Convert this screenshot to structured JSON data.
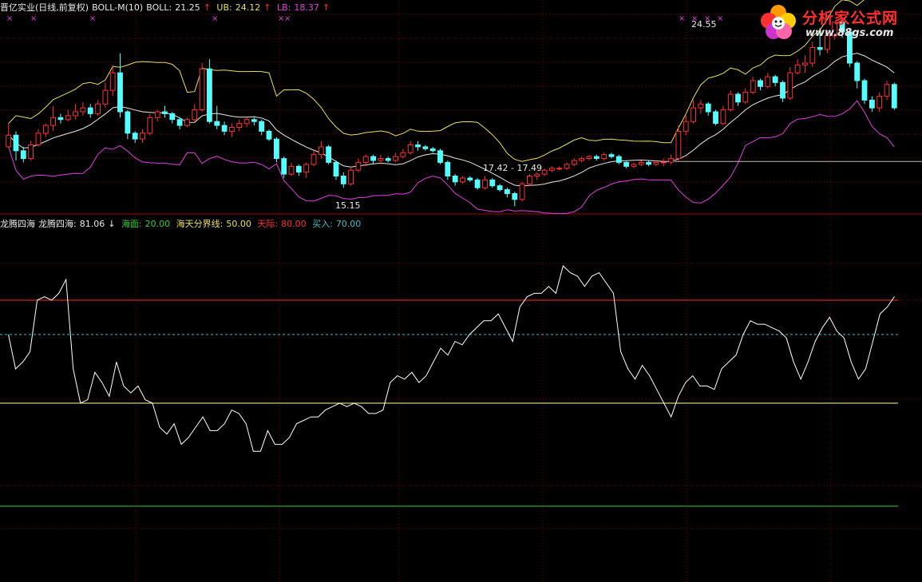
{
  "header_top": {
    "stock": "晋亿实业(日线,前复权)",
    "indicator": "BOLL-M(10)",
    "boll_label": "BOLL:",
    "boll_value": "21.25",
    "ub_label": "UB:",
    "ub_value": "24.12",
    "lb_label": "LB:",
    "lb_value": "18.37",
    "up_arrow": "↑"
  },
  "header_mid": {
    "name": "龙腾四海",
    "line_label": "龙腾四海:",
    "line_value": "81.06",
    "down_arrow": "↓",
    "sea_label": "海面:",
    "sea_value": "20.00",
    "divide_label": "海天分界线:",
    "divide_value": "50.00",
    "sky_label": "天际:",
    "sky_value": "80.00",
    "buy_label": "买入:",
    "buy_value": "70.00"
  },
  "logo": {
    "title": "分析家公式网",
    "url": "www.88gs.com"
  },
  "price_labels": {
    "high": "24.55",
    "low": "15.15",
    "range": "17.42 - 17.49",
    "marker": "×"
  },
  "colors": {
    "background": "#000000",
    "up_candle": "#ff3333",
    "down_candle": "#54ffff",
    "boll_mid": "#e8e8e8",
    "ub_line": "#e8e05a",
    "lb_line": "#e040e0",
    "indicator_line": "#ffffff",
    "sky_line": "#ff3030",
    "buy_line": "#40c0c0",
    "divide_line": "#ffff99",
    "sea_line": "#30d030",
    "grid": "#8b0000"
  },
  "chart_data": [
    {
      "type": "candlestick",
      "title": "晋亿实业(日线,前复权)",
      "ylim": [
        15.0,
        25.0
      ],
      "n_bars": 124,
      "highest": 24.55,
      "lowest": 15.15,
      "horizontal_level": 17.45,
      "boll": {
        "mid": 21.25,
        "ub": 24.12,
        "lb": 18.37
      },
      "candles": [
        [
          18.2,
          18.8,
          18.4,
          19.4
        ],
        [
          18.8,
          18.0,
          17.5,
          19.0
        ],
        [
          18.0,
          17.6,
          17.4,
          18.2
        ],
        [
          17.6,
          18.3,
          17.5,
          18.5
        ],
        [
          18.3,
          18.9,
          18.2,
          19.1
        ],
        [
          18.9,
          19.3,
          18.7,
          19.4
        ],
        [
          19.3,
          19.7,
          19.0,
          20.3
        ],
        [
          19.7,
          19.6,
          19.4,
          19.9
        ],
        [
          19.6,
          19.8,
          19.5,
          20.1
        ],
        [
          19.8,
          20.0,
          19.6,
          20.4
        ],
        [
          20.0,
          20.2,
          19.8,
          20.5
        ],
        [
          20.2,
          19.9,
          19.7,
          20.4
        ],
        [
          19.9,
          20.4,
          19.8,
          20.6
        ],
        [
          20.4,
          21.1,
          20.2,
          21.5
        ],
        [
          21.1,
          22.0,
          20.8,
          22.4
        ],
        [
          22.0,
          20.0,
          19.7,
          23.0
        ],
        [
          20.0,
          18.9,
          18.6,
          20.1
        ],
        [
          18.9,
          18.6,
          18.4,
          19.0
        ],
        [
          18.6,
          18.9,
          18.4,
          19.1
        ],
        [
          18.9,
          19.7,
          18.8,
          19.9
        ],
        [
          19.7,
          20.0,
          19.5,
          20.1
        ],
        [
          20.0,
          19.9,
          19.7,
          20.3
        ],
        [
          19.9,
          19.6,
          19.4,
          20.0
        ],
        [
          19.6,
          19.3,
          19.1,
          19.7
        ],
        [
          19.3,
          19.6,
          19.2,
          19.7
        ],
        [
          19.6,
          20.1,
          19.5,
          20.4
        ],
        [
          20.1,
          22.2,
          20.0,
          22.5
        ],
        [
          22.2,
          19.5,
          19.4,
          22.7
        ],
        [
          19.5,
          19.3,
          19.1,
          20.3
        ],
        [
          19.3,
          19.0,
          18.8,
          19.5
        ],
        [
          19.0,
          19.2,
          18.7,
          19.4
        ],
        [
          19.2,
          19.4,
          19.0,
          19.6
        ],
        [
          19.4,
          19.6,
          19.2,
          19.7
        ],
        [
          19.6,
          19.5,
          19.3,
          19.7
        ],
        [
          19.5,
          19.0,
          18.8,
          19.6
        ],
        [
          19.0,
          18.6,
          18.5,
          19.1
        ],
        [
          18.6,
          17.6,
          17.4,
          18.7
        ],
        [
          17.6,
          16.8,
          16.6,
          17.7
        ],
        [
          16.8,
          17.2,
          16.7,
          17.4
        ],
        [
          17.2,
          16.9,
          16.7,
          17.3
        ],
        [
          16.9,
          17.3,
          16.6,
          17.4
        ],
        [
          17.3,
          17.8,
          17.2,
          18.0
        ],
        [
          17.8,
          18.2,
          17.6,
          18.5
        ],
        [
          18.2,
          17.4,
          17.3,
          18.3
        ],
        [
          17.4,
          16.7,
          16.5,
          17.5
        ],
        [
          16.7,
          16.3,
          16.1,
          16.9
        ],
        [
          16.3,
          17.0,
          16.2,
          17.2
        ],
        [
          17.0,
          17.4,
          16.9,
          17.6
        ],
        [
          17.4,
          17.7,
          17.2,
          17.8
        ],
        [
          17.7,
          17.5,
          17.3,
          17.8
        ],
        [
          17.5,
          17.6,
          17.3,
          17.8
        ],
        [
          17.6,
          17.5,
          17.4,
          17.7
        ],
        [
          17.5,
          17.7,
          17.4,
          17.9
        ],
        [
          17.7,
          17.9,
          17.6,
          18.1
        ],
        [
          17.9,
          18.3,
          17.8,
          18.5
        ],
        [
          18.3,
          18.2,
          18.0,
          18.5
        ],
        [
          18.2,
          18.1,
          18.0,
          18.3
        ],
        [
          18.1,
          18.0,
          17.9,
          18.2
        ],
        [
          18.0,
          17.4,
          17.3,
          18.1
        ],
        [
          17.4,
          16.7,
          16.5,
          17.5
        ],
        [
          16.7,
          16.4,
          16.2,
          16.8
        ],
        [
          16.4,
          16.6,
          16.3,
          16.7
        ],
        [
          16.6,
          16.5,
          16.4,
          16.7
        ],
        [
          16.5,
          16.1,
          16.0,
          16.6
        ],
        [
          16.1,
          16.5,
          16.0,
          16.7
        ],
        [
          16.5,
          16.2,
          16.1,
          16.6
        ],
        [
          16.2,
          16.0,
          15.9,
          16.3
        ],
        [
          16.0,
          15.8,
          15.6,
          16.1
        ],
        [
          15.8,
          15.5,
          15.15,
          15.9
        ],
        [
          15.5,
          16.3,
          15.4,
          16.4
        ],
        [
          16.3,
          16.7,
          16.2,
          16.8
        ],
        [
          16.7,
          16.8,
          16.5,
          16.9
        ],
        [
          16.8,
          17.0,
          16.7,
          17.1
        ],
        [
          17.0,
          17.1,
          16.9,
          17.2
        ],
        [
          17.1,
          17.1,
          17.0,
          17.2
        ],
        [
          17.1,
          17.3,
          17.0,
          17.4
        ],
        [
          17.3,
          17.5,
          17.2,
          17.6
        ],
        [
          17.5,
          17.6,
          17.4,
          17.7
        ],
        [
          17.6,
          17.7,
          17.5,
          17.8
        ],
        [
          17.7,
          17.6,
          17.5,
          17.8
        ],
        [
          17.6,
          17.8,
          17.5,
          17.9
        ],
        [
          17.8,
          17.7,
          17.6,
          17.9
        ],
        [
          17.7,
          17.4,
          17.3,
          17.8
        ],
        [
          17.4,
          17.2,
          17.1,
          17.5
        ],
        [
          17.2,
          17.3,
          17.1,
          17.4
        ],
        [
          17.3,
          17.4,
          17.2,
          17.5
        ],
        [
          17.4,
          17.3,
          17.2,
          17.5
        ],
        [
          17.3,
          17.4,
          17.2,
          17.5
        ],
        [
          17.4,
          17.42,
          17.2,
          17.6
        ],
        [
          17.42,
          17.6,
          17.3,
          17.8
        ],
        [
          17.6,
          19.0,
          17.5,
          19.3
        ],
        [
          19.0,
          19.5,
          18.8,
          19.8
        ],
        [
          19.5,
          20.2,
          19.4,
          20.6
        ],
        [
          20.2,
          20.4,
          19.9,
          20.6
        ],
        [
          20.4,
          20.0,
          19.8,
          20.5
        ],
        [
          20.0,
          19.4,
          19.3,
          20.1
        ],
        [
          19.4,
          20.1,
          19.3,
          20.3
        ],
        [
          20.1,
          20.9,
          20.0,
          21.1
        ],
        [
          20.9,
          20.5,
          20.3,
          21.0
        ],
        [
          20.5,
          21.0,
          20.4,
          21.2
        ],
        [
          21.0,
          21.6,
          20.9,
          21.8
        ],
        [
          21.6,
          21.3,
          21.1,
          21.7
        ],
        [
          21.3,
          21.8,
          21.2,
          22.0
        ],
        [
          21.8,
          21.5,
          21.3,
          21.9
        ],
        [
          21.5,
          20.7,
          20.5,
          21.6
        ],
        [
          20.7,
          22.0,
          20.6,
          22.3
        ],
        [
          22.0,
          22.4,
          21.9,
          22.7
        ],
        [
          22.4,
          22.5,
          22.0,
          22.9
        ],
        [
          22.5,
          23.3,
          22.3,
          23.6
        ],
        [
          23.3,
          23.2,
          22.9,
          24.3
        ],
        [
          23.2,
          23.9,
          23.0,
          24.2
        ],
        [
          23.9,
          24.6,
          23.7,
          24.55
        ],
        [
          24.6,
          24.1,
          23.8,
          24.5
        ],
        [
          24.1,
          22.5,
          22.3,
          24.2
        ],
        [
          22.5,
          21.6,
          21.2,
          22.6
        ],
        [
          21.6,
          20.6,
          20.4,
          21.7
        ],
        [
          20.6,
          20.2,
          20.0,
          20.8
        ],
        [
          20.2,
          20.8,
          20.0,
          21.0
        ],
        [
          20.8,
          21.4,
          20.6,
          21.6
        ],
        [
          21.4,
          20.2,
          20.1,
          21.5
        ]
      ]
    },
    {
      "type": "line",
      "title": "龙腾四海",
      "ylim": [
        0,
        100
      ],
      "series": [
        {
          "name": "龙腾四海",
          "values": [
            70,
            60,
            62,
            65,
            80,
            81,
            80,
            82,
            86,
            60,
            50,
            51,
            59,
            56,
            52,
            62,
            55,
            53,
            55,
            51,
            50,
            43,
            41,
            44,
            38,
            40,
            43,
            46,
            42,
            42,
            44,
            48,
            47,
            44,
            36,
            36,
            42,
            38,
            38,
            40,
            44,
            45,
            46,
            46,
            48,
            49,
            50,
            49,
            50,
            49,
            47,
            47,
            48,
            56,
            58,
            57,
            59,
            56,
            58,
            62,
            66,
            64,
            68,
            67,
            70,
            72,
            74,
            74,
            76,
            72,
            68,
            78,
            81,
            82,
            82,
            84,
            82,
            90,
            88,
            87,
            84,
            87,
            88,
            85,
            82,
            65,
            60,
            57,
            61,
            58,
            54,
            50,
            46,
            52,
            56,
            58,
            55,
            55,
            54,
            60,
            62,
            64,
            70,
            74,
            73,
            73,
            72,
            71,
            69,
            62,
            57,
            62,
            68,
            72,
            75,
            71,
            69,
            62,
            57,
            60,
            68,
            76,
            78,
            81.06
          ]
        },
        {
          "name": "海面",
          "values": [
            20
          ]
        },
        {
          "name": "海天分界线",
          "values": [
            50
          ]
        },
        {
          "name": "天际",
          "values": [
            80
          ]
        },
        {
          "name": "买入",
          "values": [
            70
          ]
        }
      ]
    }
  ]
}
